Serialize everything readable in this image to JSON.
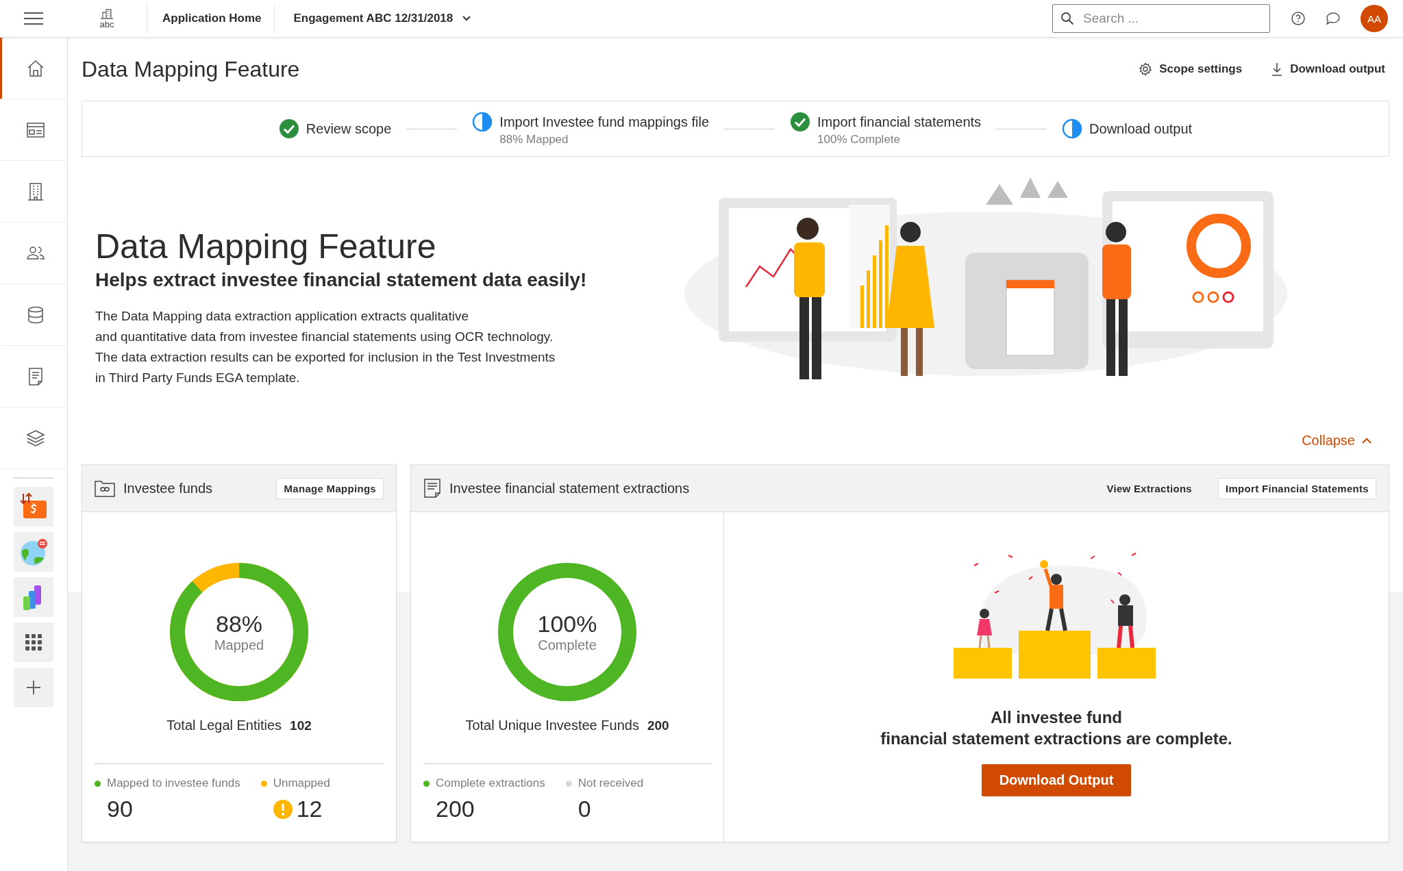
{
  "topbar": {
    "logo_text": "abc",
    "home_link": "Application Home",
    "engagement": "Engagement ABC 12/31/2018",
    "search": {
      "placeholder": "Search ..."
    },
    "avatar": "AA"
  },
  "sidebar": {
    "nav": [
      {
        "selected": true
      },
      {
        "selected": false
      },
      {
        "selected": false
      },
      {
        "selected": false
      },
      {
        "selected": false
      },
      {
        "selected": false
      },
      {
        "selected": false
      }
    ]
  },
  "page": {
    "title": "Data Mapping Feature",
    "actions": [
      "Scope settings",
      "Download output"
    ]
  },
  "steps": [
    {
      "label": "Review scope",
      "kind": "done"
    },
    {
      "label": "Import Investee fund mappings file",
      "status": "88% Mapped",
      "kind": "partial"
    },
    {
      "label": "Import financial statements",
      "status": "100% Complete",
      "kind": "done"
    },
    {
      "label": "Download output",
      "kind": "partial"
    }
  ],
  "hero": {
    "title": "Data Mapping Feature",
    "subtitle": "Helps extract investee financial statement data easily!",
    "body": [
      "The Data Mapping data extraction application extracts qualitative",
      "and quantitative data from investee financial statements using OCR technology.",
      "The data extraction results can be exported for inclusion in the Test Investments",
      "in Third Party Funds EGA template."
    ],
    "collapse": "Collapse"
  },
  "funds_card": {
    "title": "Investee funds",
    "button": "Manage Mappings",
    "gauge": {
      "value": "88%",
      "caption": "Mapped",
      "level": 0.88
    },
    "total_label": "Total Legal Entities",
    "total": "102",
    "legend": [
      {
        "label": "Mapped to investee funds",
        "color": "#4eb523",
        "value": "90",
        "warning": false
      },
      {
        "label": "Unmapped",
        "color": "#ffb600",
        "value": "12",
        "warning": true
      }
    ]
  },
  "extractions_card": {
    "title": "Investee financial statement extractions",
    "links": [
      "View Extractions"
    ],
    "button": "Import Financial Statements",
    "gauge": {
      "value": "100%",
      "caption": "Complete",
      "level": 1
    },
    "total_label": "Total Unique Investee Funds",
    "total": "200",
    "legend": [
      {
        "label": "Complete extractions",
        "color": "#4eb523",
        "value": "200",
        "warning": false
      },
      {
        "label": "Not received",
        "color": "#d9d9d9",
        "value": "0",
        "warning": false
      }
    ],
    "message": [
      "All investee fund",
      "financial statement extractions are complete."
    ],
    "download": "Download Output"
  }
}
